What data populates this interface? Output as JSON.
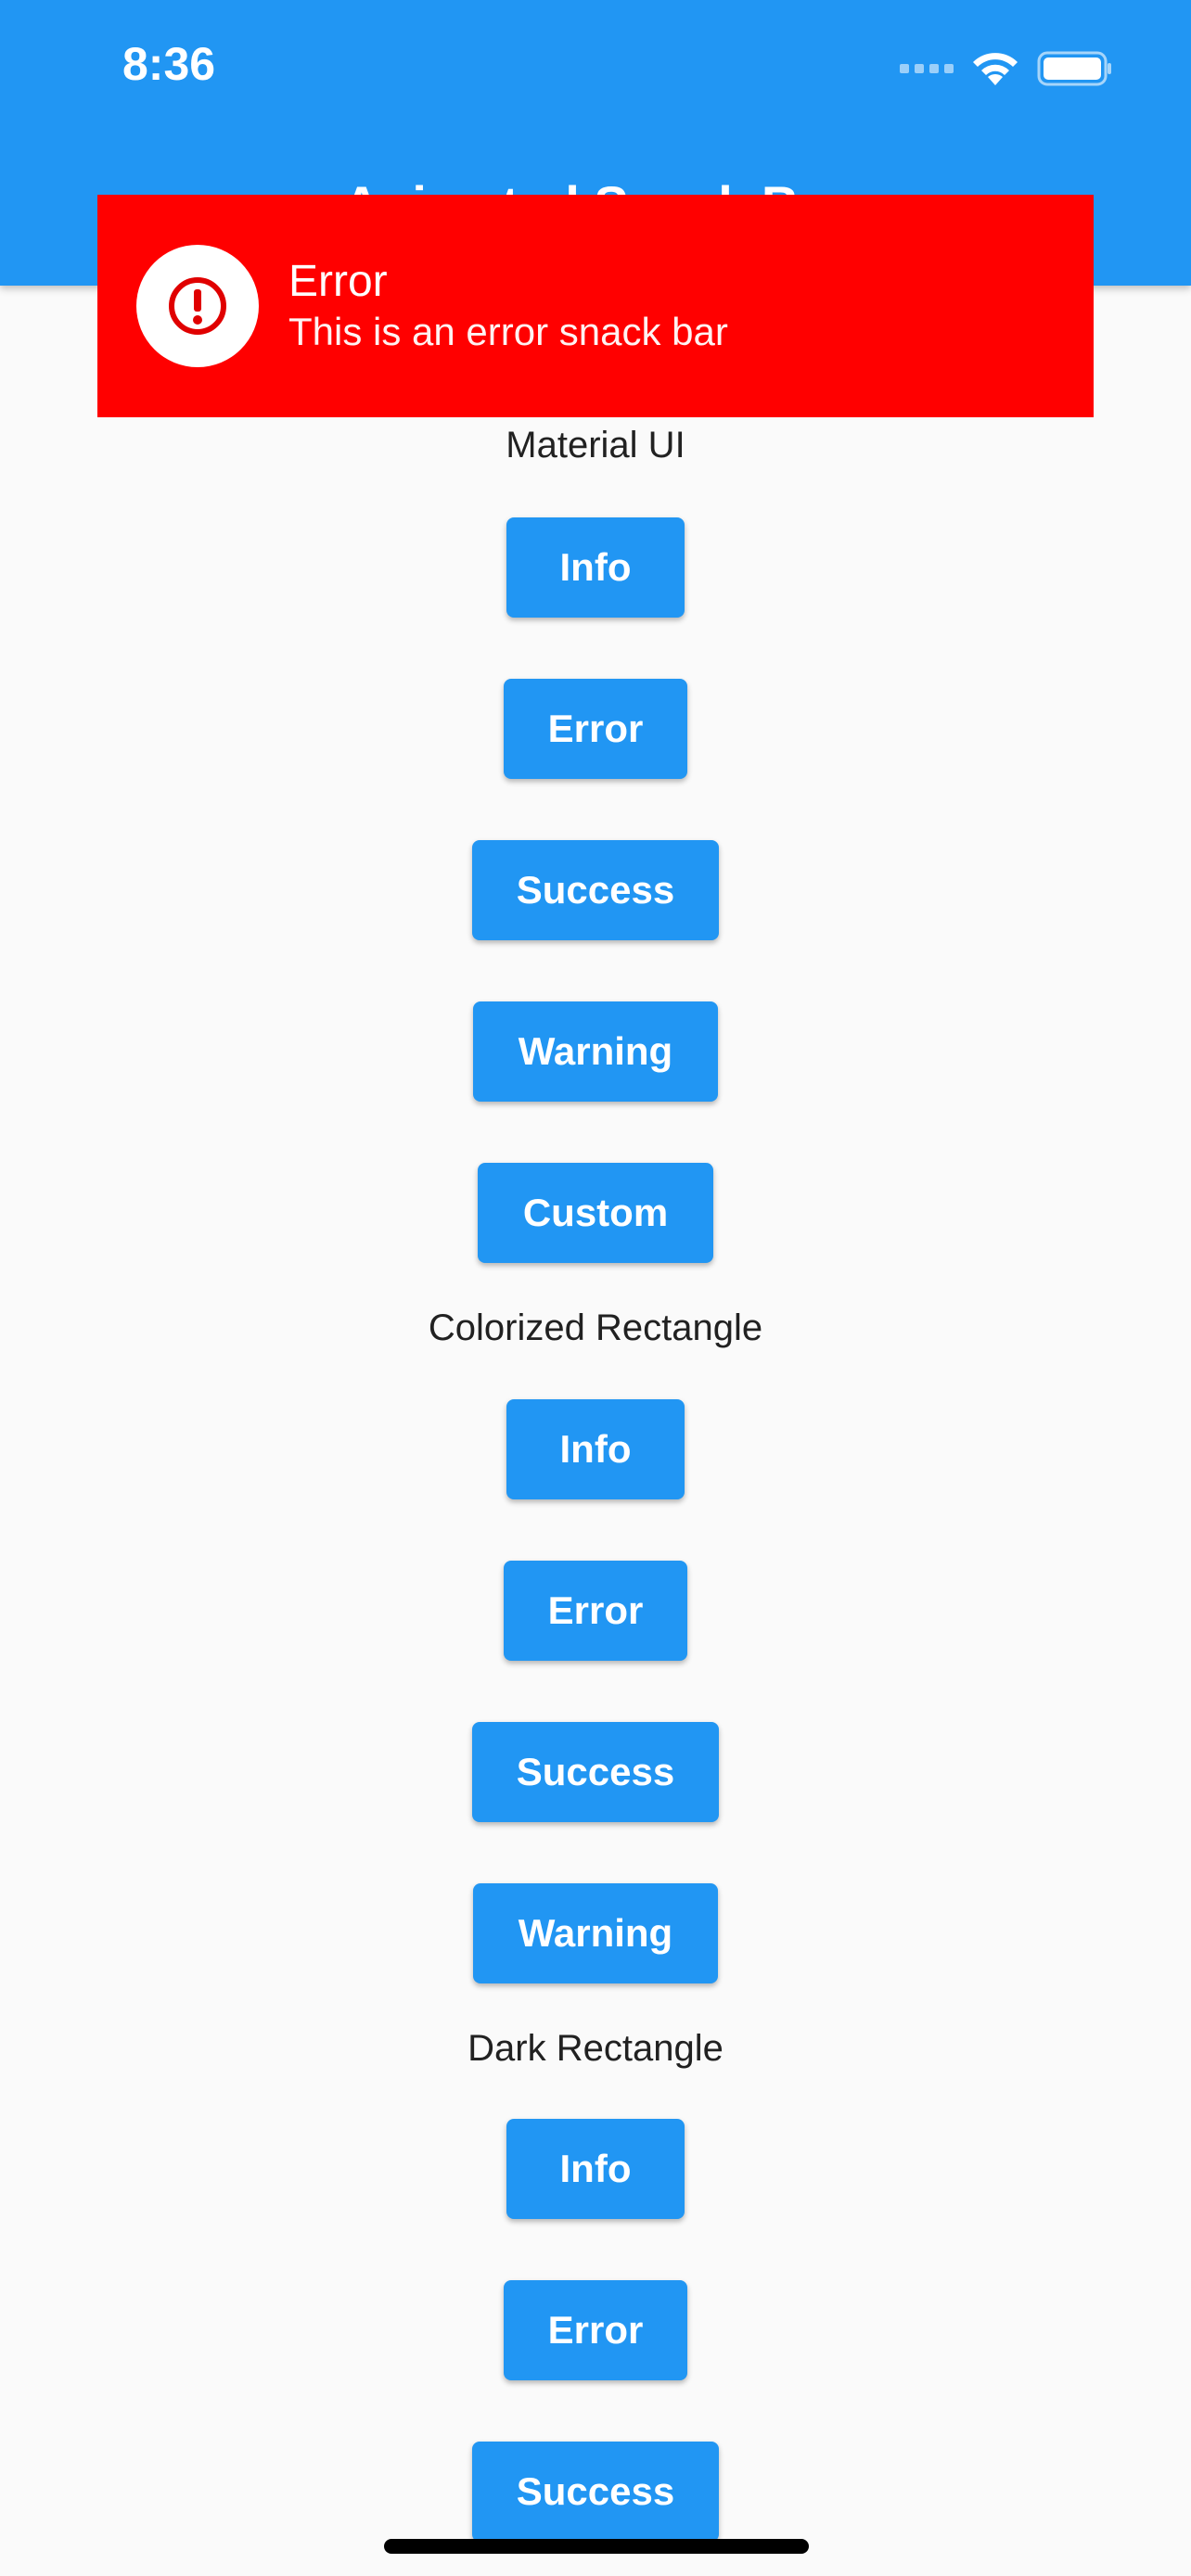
{
  "status_bar": {
    "time": "8:36"
  },
  "app_bar": {
    "title": "Animated Snack Bar",
    "color": "#2196F3"
  },
  "snackbar": {
    "title": "Error",
    "message": "This is an error snack bar",
    "icon": "alert-circle-icon",
    "color": "#FF0000"
  },
  "sections": {
    "material": {
      "label": "Material UI",
      "buttons": [
        "Info",
        "Error",
        "Success",
        "Warning",
        "Custom"
      ]
    },
    "colorized": {
      "label": "Colorized Rectangle",
      "buttons": [
        "Info",
        "Error",
        "Success",
        "Warning"
      ]
    },
    "dark": {
      "label": "Dark Rectangle",
      "buttons": [
        "Info",
        "Error",
        "Success"
      ]
    }
  },
  "colors": {
    "button": "#2196F3",
    "background": "#FAFAFA"
  }
}
